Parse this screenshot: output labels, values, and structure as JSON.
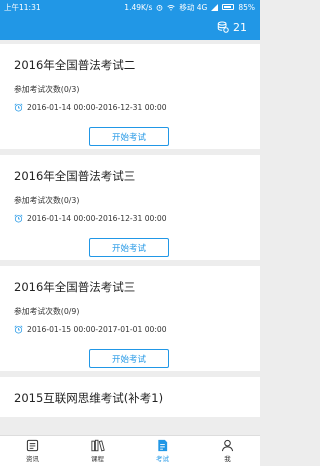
{
  "status": {
    "time": "上午11:31",
    "net": "1.49K/s",
    "carrier": "移动 4G",
    "battery": "85%"
  },
  "header": {
    "coins": "21"
  },
  "exams": [
    {
      "title": "2016年全国普法考试二",
      "count": "参加考试次数(0/3)",
      "time": "2016-01-14 00:00-2016-12-31 00:00",
      "button": "开始考试"
    },
    {
      "title": "2016年全国普法考试三",
      "count": "参加考试次数(0/3)",
      "time": "2016-01-14 00:00-2016-12-31 00:00",
      "button": "开始考试"
    },
    {
      "title": "2016年全国普法考试三",
      "count": "参加考试次数(0/9)",
      "time": "2016-01-15 00:00-2017-01-01 00:00",
      "button": "开始考试"
    },
    {
      "title": "2015互联网思维考试(补考1)"
    }
  ],
  "tabs": [
    {
      "label": "资讯",
      "icon": "news-icon"
    },
    {
      "label": "课程",
      "icon": "books-icon"
    },
    {
      "label": "考试",
      "icon": "exam-icon"
    },
    {
      "label": "我",
      "icon": "user-icon"
    }
  ],
  "colors": {
    "primary": "#2197e6"
  }
}
